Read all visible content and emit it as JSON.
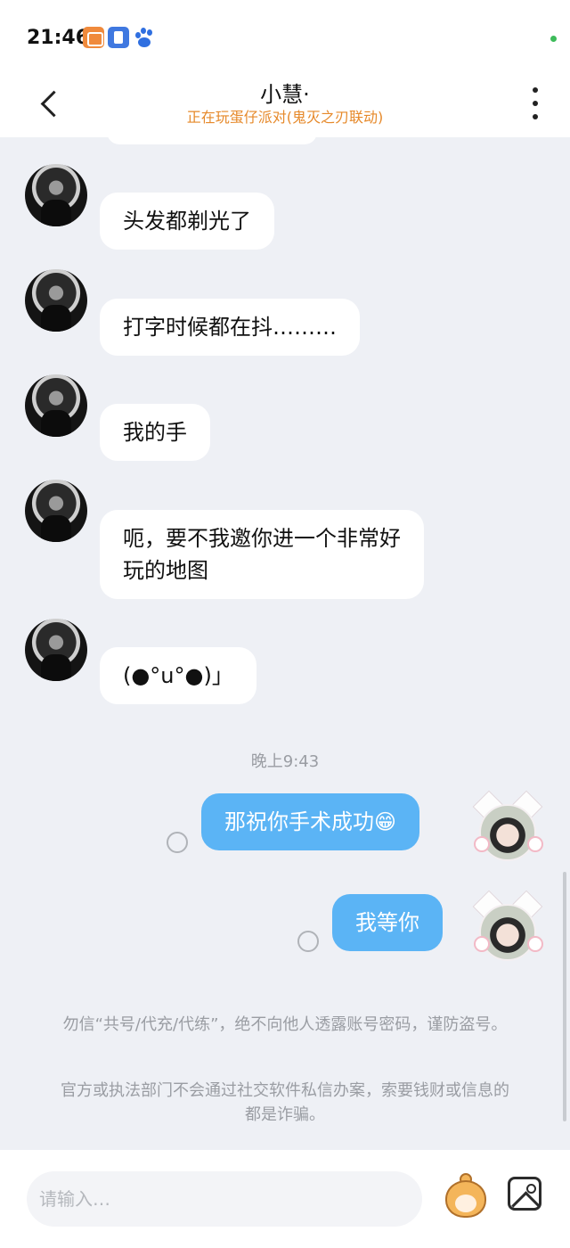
{
  "status_bar": {
    "time": "21:46",
    "icons": [
      "notification-app-icon",
      "notification-app-icon",
      "baidu-paw-icon"
    ],
    "indicator_color": "#3dbb5a"
  },
  "header": {
    "title": "小慧·",
    "status": "正在玩蛋仔派对(鬼灭之刃联动)",
    "status_color": "#e6892a"
  },
  "messages": [
    {
      "side": "received",
      "text": "头发都剃光了"
    },
    {
      "side": "received",
      "text": "打字时候都在抖………"
    },
    {
      "side": "received",
      "text": "我的手"
    },
    {
      "side": "received",
      "text": "呃，要不我邀你进一个非常好\n玩的地图"
    },
    {
      "side": "received",
      "text": "(●°u°●)」"
    },
    {
      "side": "timestamp",
      "text": "晚上9:43"
    },
    {
      "side": "sent",
      "text": "那祝你手术成功😁"
    },
    {
      "side": "sent",
      "text": "我等你"
    }
  ],
  "notices": [
    "勿信“共号/代充/代练”，绝不向他人透露账号密码，谨防盗号。",
    "官方或执法部门不会通过社交软件私信办案，索要钱财或信息的都是诈骗。"
  ],
  "input": {
    "placeholder": "请输入…"
  },
  "colors": {
    "background": "#eef0f5",
    "sent_bubble": "#5bb4f5",
    "received_bubble": "#ffffff"
  }
}
